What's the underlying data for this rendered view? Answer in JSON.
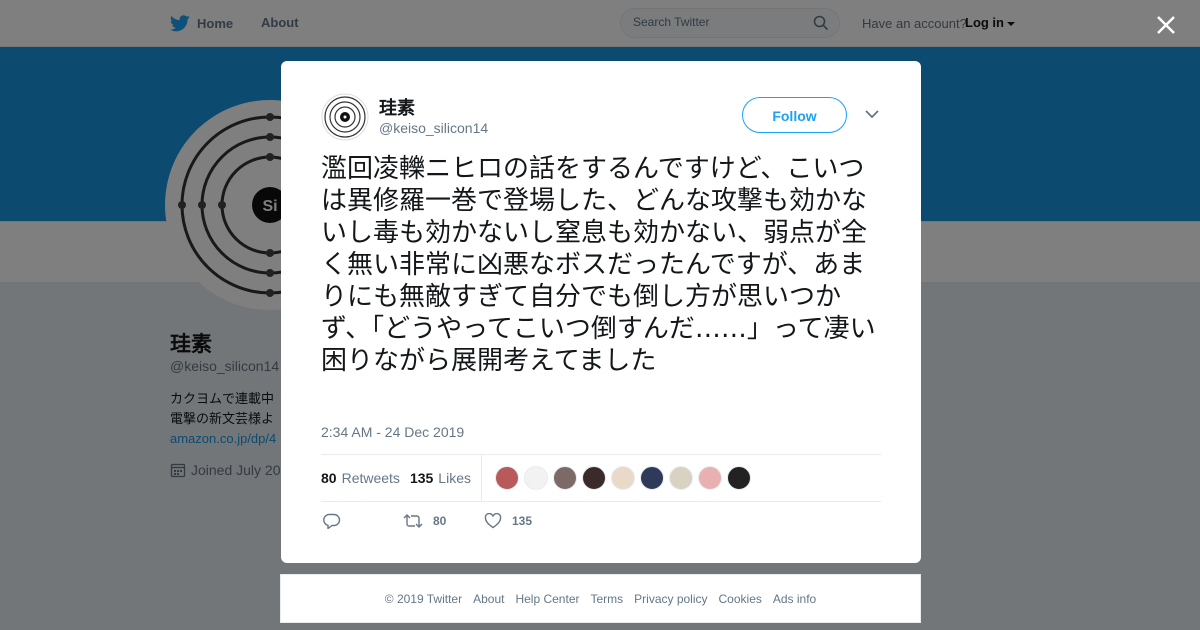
{
  "nav": {
    "home_label": "Home",
    "about_label": "About",
    "search_placeholder": "Search Twitter",
    "have_account": "Have an account?",
    "login_label": "Log in"
  },
  "profile": {
    "name": "珪素",
    "handle": "@keiso_silicon14",
    "bio_line1": "カクヨムで連載中",
    "bio_line2": "電撃の新文芸様よ",
    "bio_link": "amazon.co.jp/dp/4",
    "joined": "Joined July 20",
    "avatar_text": "Si"
  },
  "tweet": {
    "name": "珪素",
    "handle": "@keiso_silicon14",
    "follow_label": "Follow",
    "text": "濫回凌轢ニヒロの話をするんですけど、こいつは異修羅一巻で登場した、どんな攻撃も効かないし毒も効かないし窒息も効かない、弱点が全く無い非常に凶悪なボスだったんですが、あまりにも無敵すぎて自分でも倒し方が思いつかず、「どうやってこいつ倒すんだ……」って凄い困りながら展開考えてました",
    "time": "2:34 AM - 24 Dec 2019",
    "retweets_count": "80",
    "retweets_label": "Retweets",
    "likes_count": "135",
    "likes_label": "Likes",
    "action_retweet_count": "80",
    "action_like_count": "135"
  },
  "likers": [
    {
      "color": "#b85a5a"
    },
    {
      "color": "#f2f2f2"
    },
    {
      "color": "#7b6a66"
    },
    {
      "color": "#3b2a2a"
    },
    {
      "color": "#e9d9c9"
    },
    {
      "color": "#2f3a5a"
    },
    {
      "color": "#d9d2c2"
    },
    {
      "color": "#e8b0b0"
    },
    {
      "color": "#222222"
    }
  ],
  "footer": {
    "copyright": "© 2019 Twitter",
    "about": "About",
    "help": "Help Center",
    "terms": "Terms",
    "privacy": "Privacy policy",
    "cookies": "Cookies",
    "ads": "Ads info"
  },
  "colors": {
    "brand": "#1da1f2",
    "banner": "#1b95e0"
  }
}
